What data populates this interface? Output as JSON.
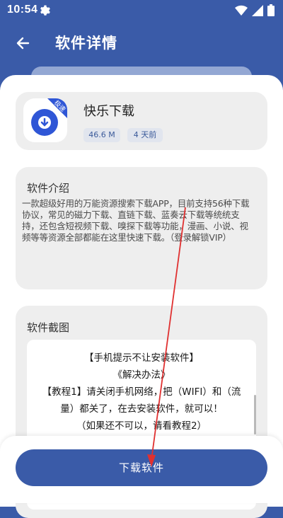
{
  "status": {
    "time": "10:54"
  },
  "header": {
    "title": "软件详情"
  },
  "app": {
    "name": "快乐下载",
    "size": "46.6 M",
    "updated": "4 天前",
    "badge": "极速"
  },
  "intro": {
    "title": "软件介绍",
    "text": "一款超级好用的万能资源搜索下载APP，目前支持56种下载协议，常见的磁力下载、直链下载、蓝奏云下载等统统支持，还包含短视频下载、嗅探下载等功能，漫画、小说、视频等等资源全部都能在这里快速下载。（登录解锁VIP）"
  },
  "screenshots": {
    "title": "软件截图",
    "lines": [
      "【手机提示不让安装软件】",
      "《解决办法》",
      "【教程1】请关闭手机网络，把（WIFI）和（流",
      "量）都关了，在去安装软件，就可以！",
      "（如果还不可以，请看教程2）"
    ]
  },
  "actions": {
    "download": "下载软件"
  },
  "colors": {
    "primary": "#3a5ba8",
    "arrow": "#e03030"
  }
}
